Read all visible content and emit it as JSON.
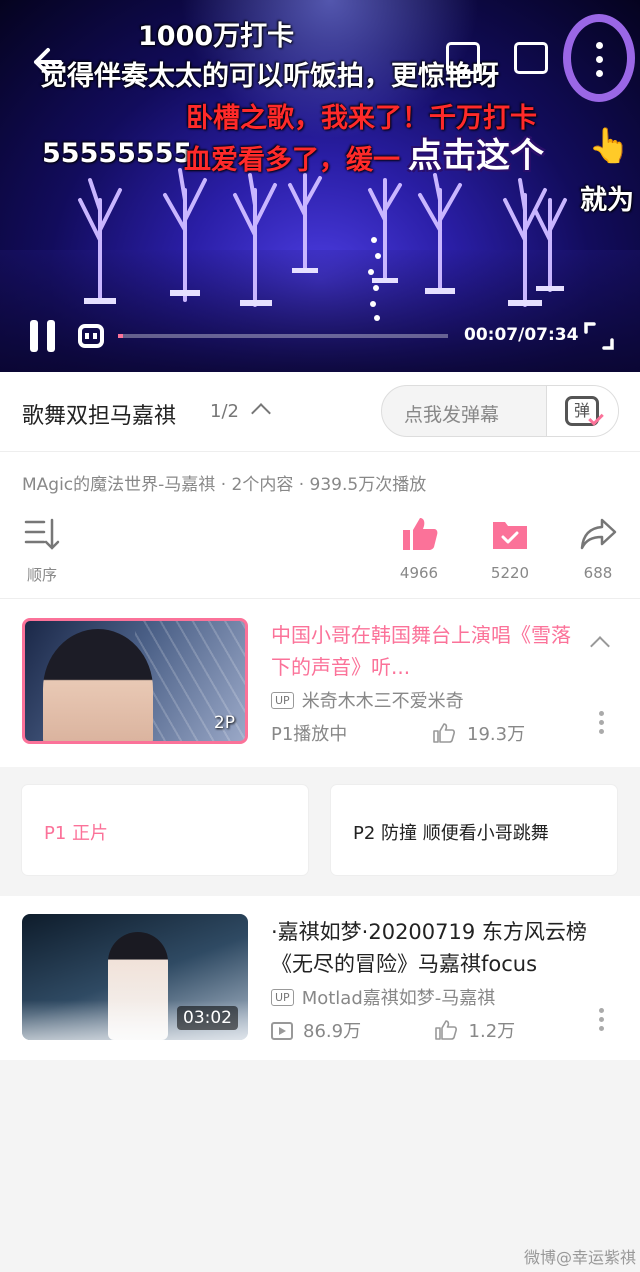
{
  "player": {
    "danmaku": [
      "1000万打卡",
      "觉得伴奏太太的可以听饭拍，更惊艳呀",
      "卧槽之歌，我来了！千万打卡",
      "55555555",
      "血爱看多了，缓一",
      "点击这个",
      "就为"
    ],
    "time": "00:07/07:34",
    "progress_fraction": 0.015,
    "hand_icon": "pointing-hand-icon",
    "highlight_color": "#9a67e6"
  },
  "collection": {
    "title": "歌舞双担马嘉祺",
    "page": "1/2",
    "danmaku_placeholder": "点我发弹幕",
    "danmaku_send_label": "弹"
  },
  "meta": {
    "info": "MAgic的魔法世界-马嘉祺 · 2个内容 · 939.5万次播放",
    "sort_label": "顺序",
    "likes": "4966",
    "favorites": "5220",
    "shares": "688"
  },
  "episode": {
    "title": "中国小哥在韩国舞台上演唱《雪落下的声音》听...",
    "up_badge": "UP",
    "uploader": "米奇木木三不爱米奇",
    "status": "P1播放中",
    "likes": "19.3万",
    "badge": "2P",
    "parts": [
      "P1 正片",
      "P2 防撞 顺便看小哥跳舞"
    ]
  },
  "related": {
    "title": "·嘉祺如梦·20200719 东方风云榜《无尽的冒险》马嘉祺focus",
    "up_badge": "UP",
    "uploader": "Motlad嘉祺如梦-马嘉祺",
    "views": "86.9万",
    "likes": "1.2万",
    "duration": "03:02"
  },
  "watermark": "微博@幸运紫祺_",
  "colors": {
    "accent": "#fb7299",
    "text": "#222222",
    "muted": "#888888"
  }
}
